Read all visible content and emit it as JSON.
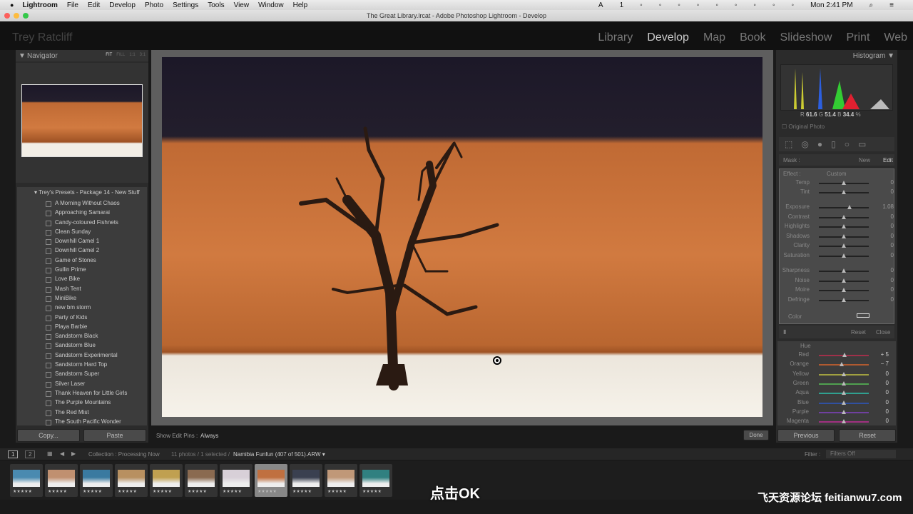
{
  "menubar": {
    "apple": "",
    "items": [
      "Lightroom",
      "File",
      "Edit",
      "Develop",
      "Photo",
      "Settings",
      "Tools",
      "View",
      "Window",
      "Help"
    ],
    "clock": "Mon 2:41 PM",
    "badge": "1"
  },
  "window_title": "The Great Library.lrcat - Adobe Photoshop Lightroom - Develop",
  "identity_plate": "Trey Ratcliff",
  "modules": [
    "Library",
    "Develop",
    "Map",
    "Book",
    "Slideshow",
    "Print",
    "Web"
  ],
  "navigator": {
    "title": "Navigator",
    "zoom_options": [
      "FIT",
      "FILL",
      "1:1",
      "3:1"
    ]
  },
  "presets": {
    "folder": "Trey's Presets - Package 14 - New Stuff",
    "items": [
      "A Morning Without Chaos",
      "Approaching Samarai",
      "Candy-coloured Fishnets",
      "Clean Sunday",
      "Downhill Camel 1",
      "Downhill Camel 2",
      "Game of Stones",
      "Gullin Prime",
      "Love Bike",
      "Mash Tent",
      "MiniBike",
      "new bm storm",
      "Party of Kids",
      "Playa Barbie",
      "Sandstorm Black",
      "Sandstorm Blue",
      "Sandstorm Experimental",
      "Sandstorm Hard Top",
      "Sandstorm Super",
      "Silver Laser",
      "Thank Heaven for Little Girls",
      "The Purple Mountains",
      "The Red Mist",
      "The South Pacific Wonder"
    ]
  },
  "left_buttons": {
    "copy": "Copy...",
    "paste": "Paste"
  },
  "toolbar": {
    "edit_pins_label": "Show Edit Pins :",
    "edit_pins_value": "Always",
    "done": "Done"
  },
  "histogram": {
    "title": "Histogram",
    "r_label": "R",
    "r": "61.6",
    "g_label": "G",
    "g": "51.4",
    "b_label": "B",
    "b": "34.4",
    "pct": "%",
    "original_photo": "Original Photo"
  },
  "mask": {
    "label": "Mask :",
    "new": "New",
    "edit": "Edit",
    "effect_label": "Effect :",
    "effect_value": "Custom",
    "color_label": "Color",
    "reset": "Reset",
    "close": "Close"
  },
  "sliders": [
    {
      "label": "Temp",
      "value": "0",
      "pos": 0.5
    },
    {
      "label": "Tint",
      "value": "0",
      "pos": 0.5
    },
    {
      "label": "Exposure",
      "value": "1.08",
      "pos": 0.62
    },
    {
      "label": "Contrast",
      "value": "0",
      "pos": 0.5
    },
    {
      "label": "Highlights",
      "value": "0",
      "pos": 0.5
    },
    {
      "label": "Shadows",
      "value": "0",
      "pos": 0.5
    },
    {
      "label": "Clarity",
      "value": "0",
      "pos": 0.5
    },
    {
      "label": "Saturation",
      "value": "0",
      "pos": 0.5
    },
    {
      "label": "Sharpness",
      "value": "0",
      "pos": 0.5
    },
    {
      "label": "Noise",
      "value": "0",
      "pos": 0.5
    },
    {
      "label": "Moire",
      "value": "0",
      "pos": 0.5
    },
    {
      "label": "Defringe",
      "value": "0",
      "pos": 0.5
    }
  ],
  "hue": {
    "title": "Hue",
    "items": [
      {
        "label": "Red",
        "value": "+ 5",
        "pos": 0.52,
        "color": "#a0304a"
      },
      {
        "label": "Orange",
        "value": "− 7",
        "pos": 0.46,
        "color": "#b05a30"
      },
      {
        "label": "Yellow",
        "value": "0",
        "pos": 0.5,
        "color": "#a0a040"
      },
      {
        "label": "Green",
        "value": "0",
        "pos": 0.5,
        "color": "#50a050"
      },
      {
        "label": "Aqua",
        "value": "0",
        "pos": 0.5,
        "color": "#30a090"
      },
      {
        "label": "Blue",
        "value": "0",
        "pos": 0.5,
        "color": "#3050a0"
      },
      {
        "label": "Purple",
        "value": "0",
        "pos": 0.5,
        "color": "#7040a0"
      },
      {
        "label": "Magenta",
        "value": "0",
        "pos": 0.5,
        "color": "#a03080"
      }
    ]
  },
  "right_buttons": {
    "previous": "Previous",
    "reset": "Reset"
  },
  "filmbar": {
    "page1": "1",
    "page2": "2",
    "source": "Collection : Processing Now",
    "count": "11 photos / 1 selected /",
    "filename": "Namibia Funfun (407 of 501).ARW",
    "filter_label": "Filter :",
    "filter_value": "Filters Off"
  },
  "filmstrip": {
    "stars": "★★★★★",
    "selected_index": 7,
    "thumb_colors": [
      "#4a8ab0",
      "#c09070",
      "#3a7aa0",
      "#b89060",
      "#c0a050",
      "#8a6a50",
      "#d8d0d8",
      "#c07040",
      "#3a4050",
      "#c09878",
      "#308080"
    ]
  },
  "subtitle": "点击OK",
  "watermark": "飞天资源论坛 feitianwu7.com"
}
